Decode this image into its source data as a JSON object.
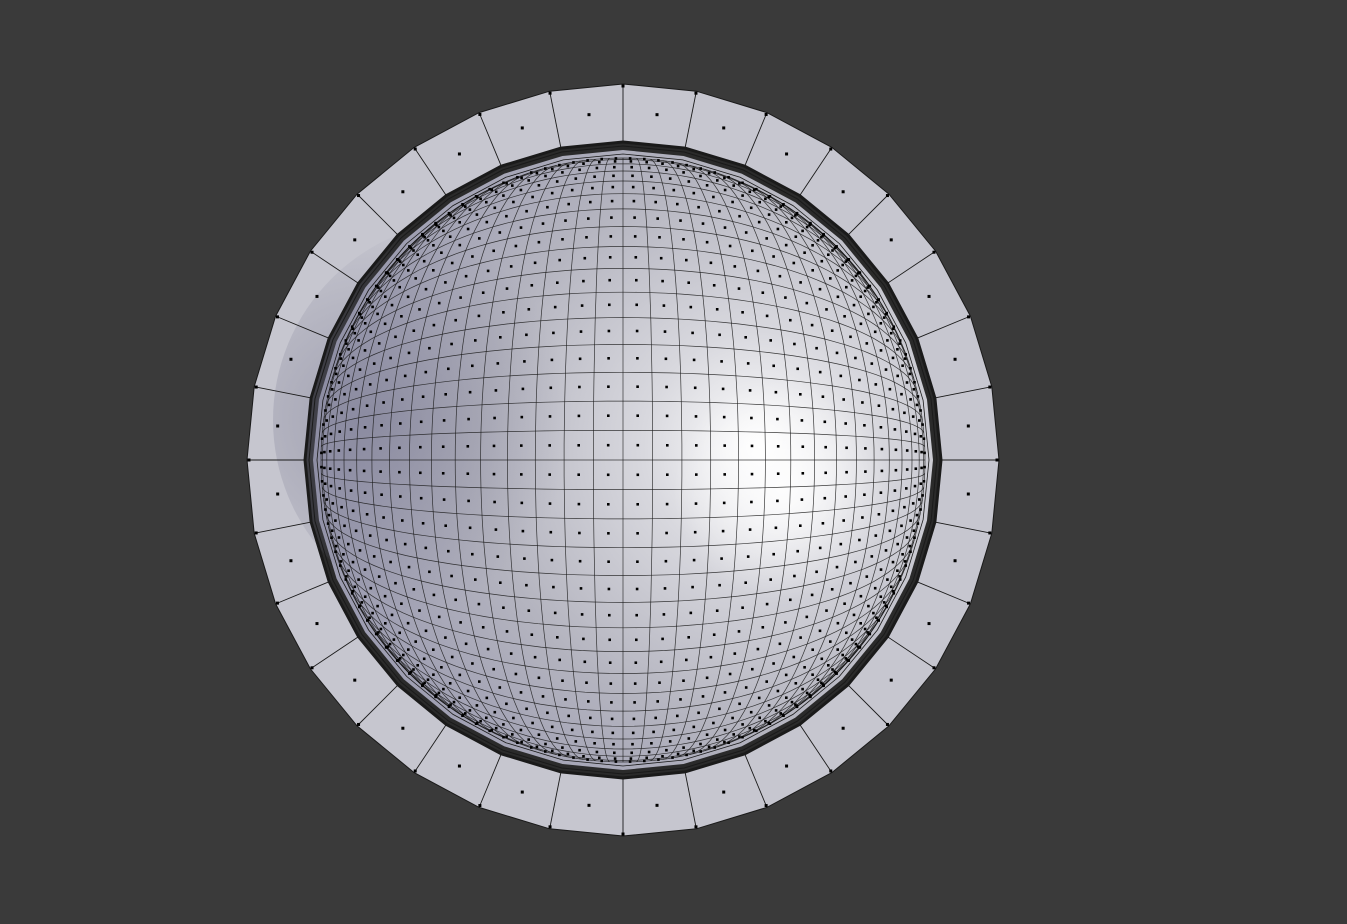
{
  "viewport": {
    "background_color": "#3a3a3a",
    "mode": "edit-mode-face-select",
    "view": "top-orthographic"
  },
  "mesh": {
    "object_type": "hemisphere-bowl",
    "rim_fill": "#c6c6cf",
    "bowl_light": "#f4f4f6",
    "bowl_mid": "#b8b8c2",
    "bowl_shadow": "#9a9ab0",
    "wire_color": "#1a1a1a",
    "face_dot_color": "#000000",
    "radial_segments": 32,
    "rings": 16
  }
}
